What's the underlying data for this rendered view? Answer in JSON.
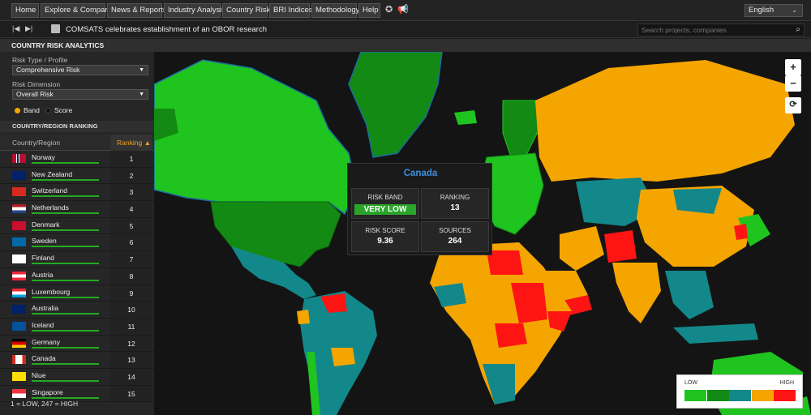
{
  "nav": {
    "items": [
      "Home",
      "Explore & Compare",
      "News & Reports",
      "Industry Analysis",
      "Country Risk",
      "BRI Indices",
      "Methodology",
      "Help"
    ],
    "language": "English"
  },
  "news": {
    "headline": "COMSATS celebrates establishment of an OBOR research",
    "search_placeholder": "Search projects, companies"
  },
  "panel": {
    "title": "COUNTRY RISK ANALYTICS",
    "risk_type_label": "Risk Type / Profile",
    "risk_type_value": "Comprehensive Risk",
    "risk_dimension_label": "Risk Dimension",
    "risk_dimension_value": "Overall Risk",
    "radio_band": "Band",
    "radio_score": "Score",
    "ranking_title": "COUNTRY/REGION RANKING",
    "col_country": "Country/Region",
    "col_ranking": "Ranking",
    "footer_note": "1 = LOW, 247 = HIGH"
  },
  "rankings": [
    {
      "name": "Norway",
      "rank": "1",
      "flag": "no"
    },
    {
      "name": "New Zealand",
      "rank": "2",
      "flag": "nz"
    },
    {
      "name": "Switzerland",
      "rank": "3",
      "flag": "ch"
    },
    {
      "name": "Netherlands",
      "rank": "4",
      "flag": "nl"
    },
    {
      "name": "Denmark",
      "rank": "5",
      "flag": "dk"
    },
    {
      "name": "Sweden",
      "rank": "6",
      "flag": "se"
    },
    {
      "name": "Finland",
      "rank": "7",
      "flag": "fi"
    },
    {
      "name": "Austria",
      "rank": "8",
      "flag": "at"
    },
    {
      "name": "Luxembourg",
      "rank": "9",
      "flag": "lu"
    },
    {
      "name": "Australia",
      "rank": "10",
      "flag": "au"
    },
    {
      "name": "Iceland",
      "rank": "11",
      "flag": "is"
    },
    {
      "name": "Germany",
      "rank": "12",
      "flag": "de"
    },
    {
      "name": "Canada",
      "rank": "13",
      "flag": "ca"
    },
    {
      "name": "Niue",
      "rank": "14",
      "flag": "nu"
    },
    {
      "name": "Singapore",
      "rank": "15",
      "flag": "sg"
    }
  ],
  "tooltip": {
    "country": "Canada",
    "risk_band_label": "RISK BAND",
    "risk_band_value": "VERY LOW",
    "ranking_label": "RANKING",
    "ranking_value": "13",
    "risk_score_label": "RISK SCORE",
    "risk_score_value": "9.36",
    "sources_label": "SOURCES",
    "sources_value": "264"
  },
  "map_legend": {
    "low": "LOW",
    "high": "HIGH",
    "colors": [
      "#1fc41f",
      "#138a13",
      "#12888a",
      "#f5a500",
      "#ff1414"
    ]
  },
  "colors": {
    "very_low": "#1fc41f",
    "low": "#138a13",
    "medium": "#12888a",
    "high": "#f5a500",
    "very_high": "#ff1414",
    "accent": "#3d8fe0"
  }
}
